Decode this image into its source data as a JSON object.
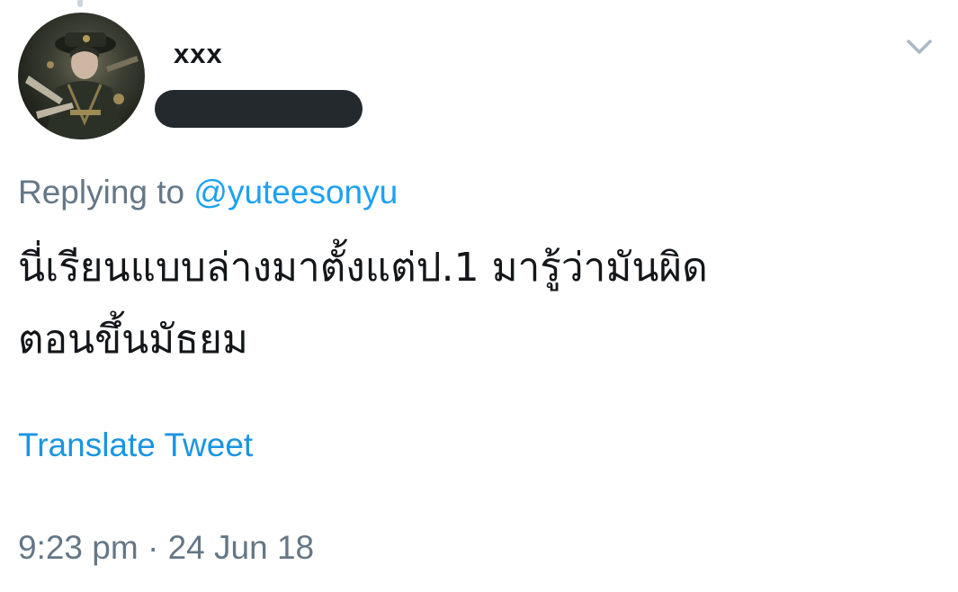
{
  "tweet": {
    "author": {
      "display_name": "xxx",
      "avatar_icon": "user-avatar-icon"
    },
    "reply": {
      "prefix": "Replying to ",
      "mention": "@yuteesonyu"
    },
    "text": "นี่เรียนแบบล่างมาตั้งแต่ป.1 มารู้ว่ามันผิด\nตอนขึ้นมัธยม",
    "translate_label": "Translate Tweet",
    "timestamp": "9:23 pm · 24 Jun 18",
    "menu_icon": "chevron-down-icon"
  },
  "colors": {
    "link": "#1da1f2",
    "translate": "#1b95e0",
    "muted": "#657786",
    "text": "#14171a",
    "redaction": "#24292e"
  }
}
